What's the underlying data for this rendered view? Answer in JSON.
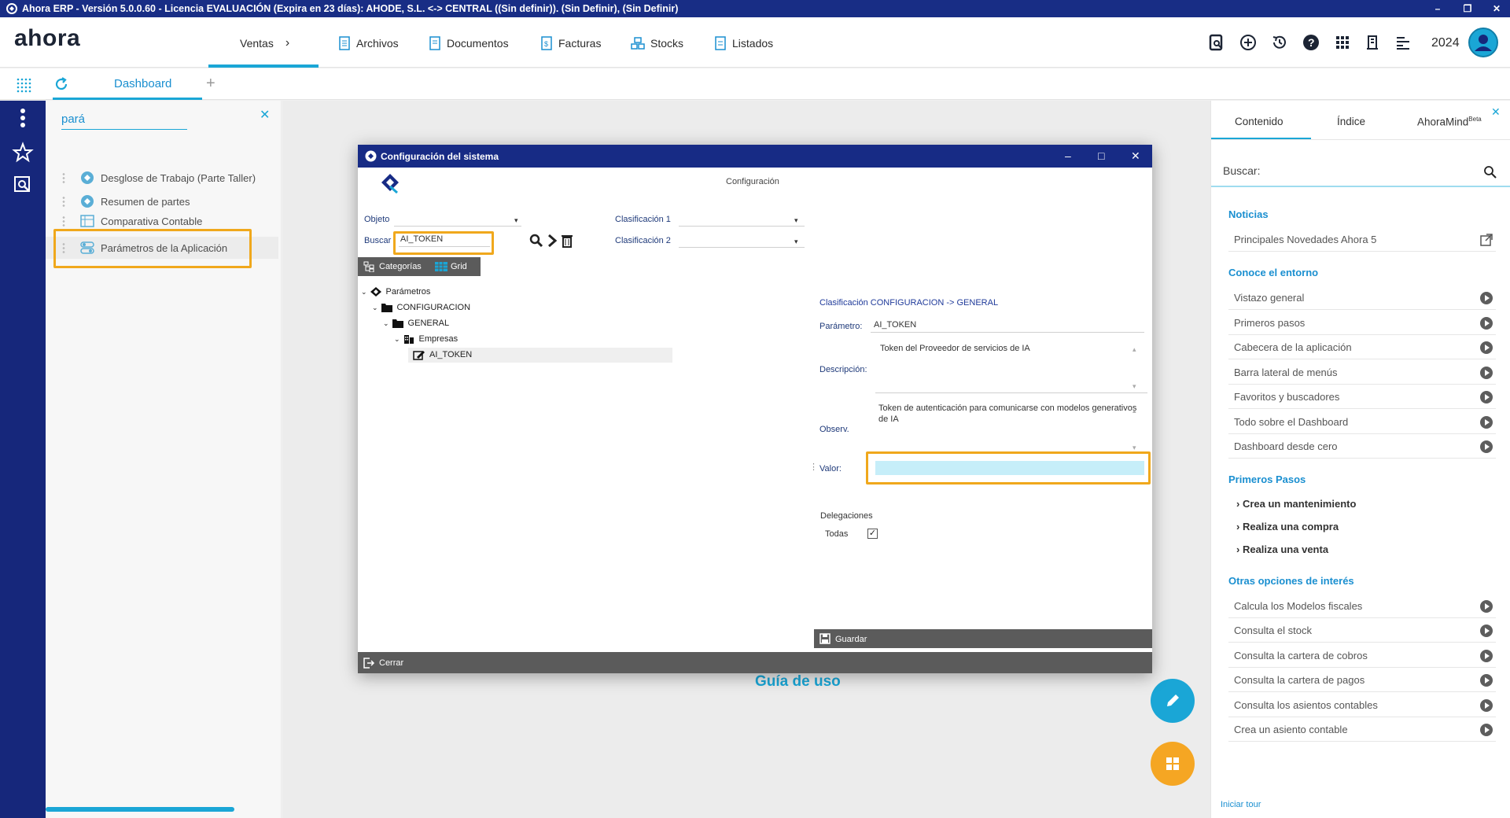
{
  "titlebar": {
    "title": "Ahora ERP - Versión 5.0.0.60 - Licencia EVALUACIÓN (Expira en 23 días): AHODE, S.L. <-> CENTRAL ((Sin definir)). (Sin Definir), (Sin Definir)"
  },
  "topnav": {
    "logo": "ahora",
    "tabs": [
      "Ventas",
      "Archivos",
      "Documentos",
      "Facturas",
      "Stocks",
      "Listados"
    ],
    "year": "2024"
  },
  "tabbar": {
    "dashboard": "Dashboard",
    "add": "+"
  },
  "search": {
    "query": "pará",
    "results": [
      "Desglose de Trabajo (Parte Taller)",
      "Resumen de partes",
      "Comparativa Contable",
      "Parámetros de la Aplicación"
    ]
  },
  "main": {
    "guia": "Guía de uso"
  },
  "dialog": {
    "title": "Configuración del sistema",
    "subtitle": "Configuración",
    "objeto_label": "Objeto",
    "buscar_label": "Buscar",
    "buscar_value": "AI_TOKEN",
    "clasif1_label": "Clasificación 1",
    "clasif2_label": "Clasificación 2",
    "tab_categorias": "Categorías",
    "tab_grid": "Grid",
    "tree": [
      "Parámetros",
      "CONFIGURACION",
      "GENERAL",
      "Empresas",
      "AI_TOKEN"
    ],
    "clasificacion_heading": "Clasificación CONFIGURACION -> GENERAL",
    "parametro_label": "Parámetro:",
    "parametro_value": "AI_TOKEN",
    "descripcion_label": "Descripción:",
    "descripcion_value": "Token del Proveedor de servicios de IA",
    "observ_label": "Observ.",
    "observ_value": "Token de autenticación para comunicarse con modelos generativos de IA",
    "valor_label": "Valor:",
    "valor_value": "",
    "delegaciones_label": "Delegaciones",
    "todas_label": "Todas",
    "todas_checked": true,
    "guardar": "Guardar",
    "cerrar": "Cerrar"
  },
  "rightpanel": {
    "tabs": [
      "Contenido",
      "Índice",
      "AhoraMind"
    ],
    "beta": "Beta",
    "search_placeholder": "Buscar:",
    "sections": {
      "noticias": "Noticias",
      "conoce": "Conoce el entorno",
      "primeros": "Primeros Pasos",
      "otras": "Otras opciones de interés"
    },
    "noticias_items": [
      "Principales Novedades Ahora 5"
    ],
    "conoce_items": [
      "Vistazo general",
      "Primeros pasos",
      "Cabecera de la aplicación",
      "Barra lateral de menús",
      "Favoritos y buscadores",
      "Todo sobre el Dashboard",
      "Dashboard desde cero"
    ],
    "primeros_items": [
      "Crea un mantenimiento",
      "Realiza una compra",
      "Realiza una venta"
    ],
    "otras_items": [
      "Calcula los Modelos fiscales",
      "Consulta el stock",
      "Consulta la cartera de cobros",
      "Consulta la cartera de pagos",
      "Consulta los asientos contables",
      "Crea un asiento contable"
    ],
    "iniciar_tour": "Iniciar tour"
  },
  "colors": {
    "brand_blue": "#16277b",
    "accent": "#1aa6d6",
    "highlight": "#f0a81c",
    "fab_orange": "#f5a623"
  }
}
